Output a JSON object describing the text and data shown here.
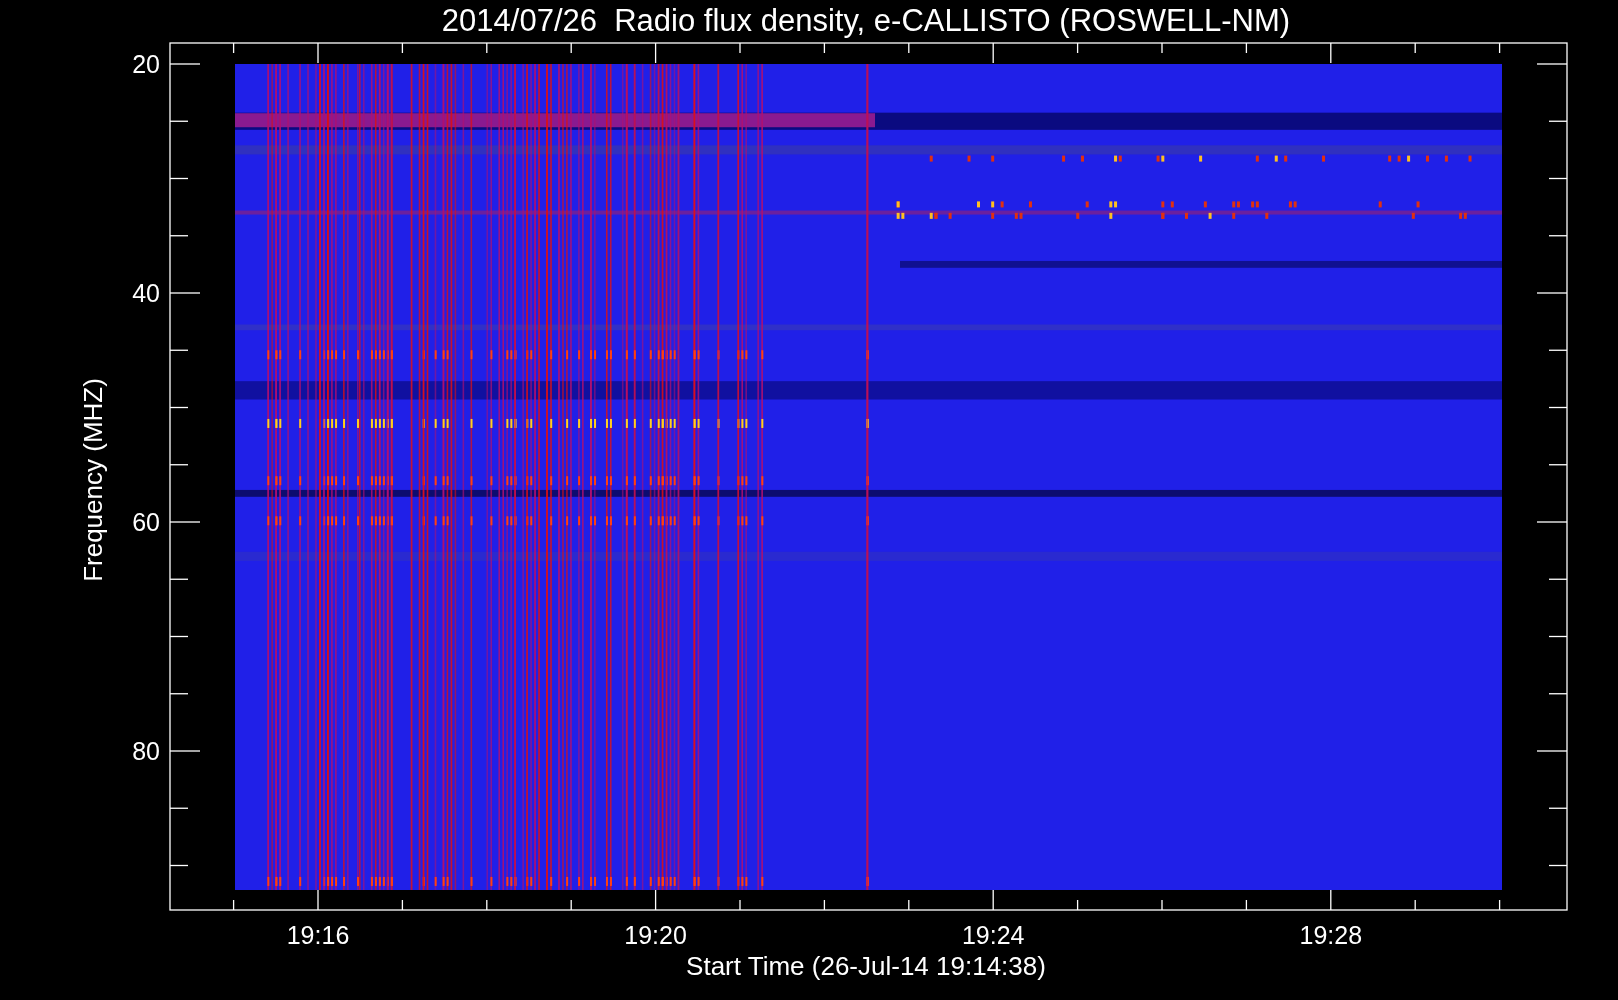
{
  "title": "2014/07/26  Radio flux density, e-CALLISTO (ROSWELL-NM)",
  "y_axis": {
    "label": "Frequency (MHZ)",
    "ticks": [
      "20",
      "40",
      "60",
      "80"
    ]
  },
  "x_axis": {
    "label": "Start Time (26-Jul-14 19:14:38)",
    "ticks": [
      "19:16",
      "19:20",
      "19:24",
      "19:28"
    ]
  }
}
